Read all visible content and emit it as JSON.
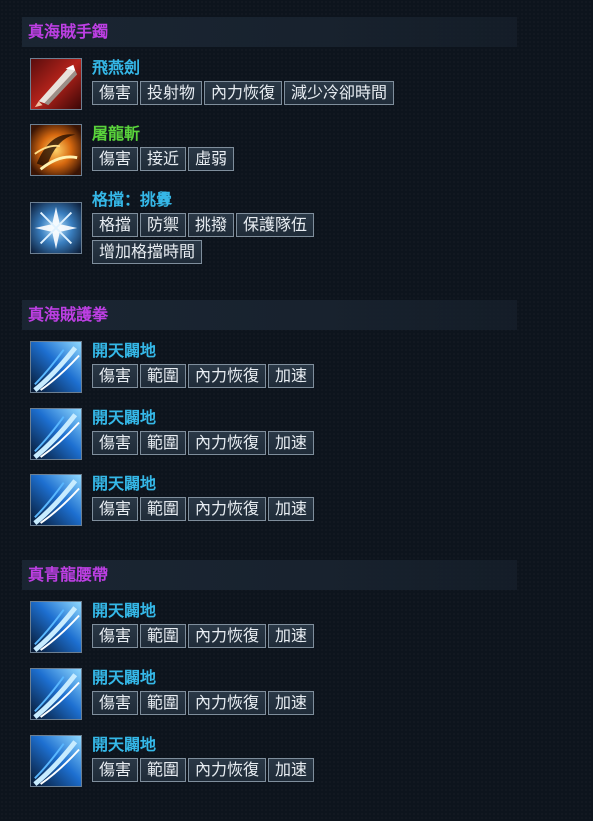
{
  "colors": {
    "section_title": "#bd3fe3",
    "skill_blue": "#35b8e8",
    "skill_green": "#59d33b",
    "tag_text": "#e8edf2",
    "tag_border": "#7f8e9c"
  },
  "sections": [
    {
      "title": "真海賊手鐲",
      "items": [
        {
          "name": "飛燕劍",
          "name_color": "#35b8e8",
          "icon": "flying-sword-icon",
          "tags": [
            "傷害",
            "投射物",
            "內力恢復",
            "減少冷卻時間"
          ]
        },
        {
          "name": "屠龍斬",
          "name_color": "#59d33b",
          "icon": "dragon-slash-icon",
          "tags": [
            "傷害",
            "接近",
            "虛弱"
          ]
        },
        {
          "name": "格擋：挑釁",
          "name_color": "#35b8e8",
          "icon": "block-provoke-icon",
          "tags": [
            "格擋",
            "防禦",
            "挑撥",
            "保護隊伍",
            "增加格擋時間"
          ]
        }
      ]
    },
    {
      "title": "真海賊護拳",
      "items": [
        {
          "name": "開天闢地",
          "name_color": "#35b8e8",
          "icon": "sky-splitter-icon",
          "tags": [
            "傷害",
            "範圍",
            "內力恢復",
            "加速"
          ]
        },
        {
          "name": "開天闢地",
          "name_color": "#35b8e8",
          "icon": "sky-splitter-icon",
          "tags": [
            "傷害",
            "範圍",
            "內力恢復",
            "加速"
          ]
        },
        {
          "name": "開天闢地",
          "name_color": "#35b8e8",
          "icon": "sky-splitter-icon",
          "tags": [
            "傷害",
            "範圍",
            "內力恢復",
            "加速"
          ]
        }
      ]
    },
    {
      "title": "真青龍腰帶",
      "items": [
        {
          "name": "開天闢地",
          "name_color": "#35b8e8",
          "icon": "sky-splitter-icon",
          "tags": [
            "傷害",
            "範圍",
            "內力恢復",
            "加速"
          ]
        },
        {
          "name": "開天闢地",
          "name_color": "#35b8e8",
          "icon": "sky-splitter-icon",
          "tags": [
            "傷害",
            "範圍",
            "內力恢復",
            "加速"
          ]
        },
        {
          "name": "開天闢地",
          "name_color": "#35b8e8",
          "icon": "sky-splitter-icon",
          "tags": [
            "傷害",
            "範圍",
            "內力恢復",
            "加速"
          ]
        }
      ]
    }
  ]
}
